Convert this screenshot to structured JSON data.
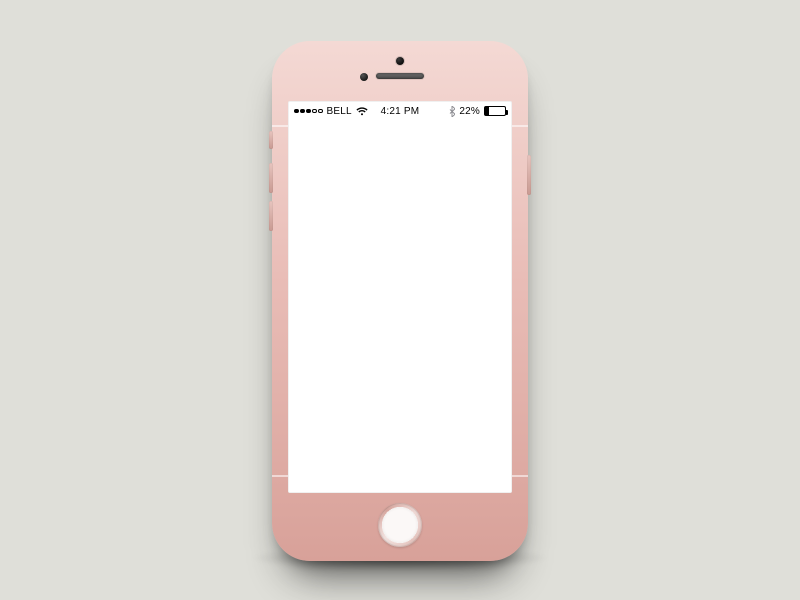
{
  "status_bar": {
    "carrier": "BELL",
    "signal_filled_dots": 3,
    "signal_total_dots": 5,
    "time": "4:21 PM",
    "battery_percent_label": "22%",
    "battery_percent_value": 22
  }
}
